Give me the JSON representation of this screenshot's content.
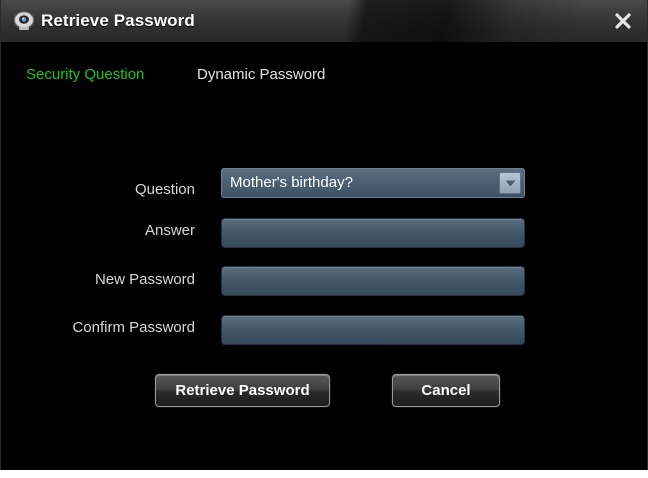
{
  "window": {
    "title": "Retrieve Password",
    "icons": {
      "app": "camera-app-icon",
      "close": "close-icon"
    }
  },
  "tabs": [
    {
      "label": "Security Question",
      "active": true,
      "color": "#18c818"
    },
    {
      "label": "Dynamic Password",
      "active": false,
      "color": "#e2e2e2"
    }
  ],
  "form": {
    "question": {
      "label": "Question",
      "selected": "Mother's birthday?"
    },
    "answer": {
      "label": "Answer",
      "value": ""
    },
    "new_password": {
      "label": "New Password",
      "value": ""
    },
    "confirm_password": {
      "label": "Confirm Password",
      "value": ""
    }
  },
  "buttons": {
    "retrieve": "Retrieve Password",
    "cancel": "Cancel"
  },
  "colors": {
    "background": "#000000",
    "accent_active_tab": "#18c818",
    "field_fill": "#44586a"
  }
}
